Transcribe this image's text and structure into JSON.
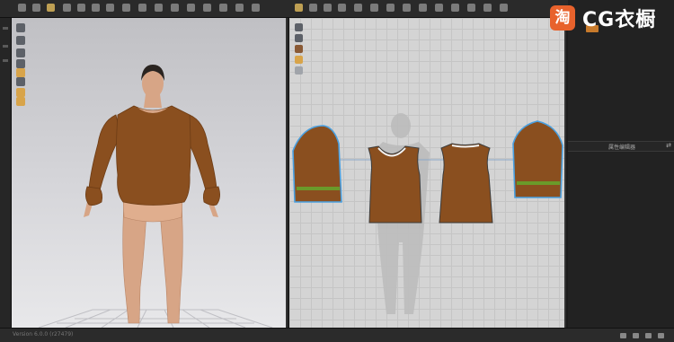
{
  "brand": {
    "logo_char": "淘",
    "name": "CG衣橱",
    "color": "#e8622c"
  },
  "panels": {
    "property_editor_title": "属性编辑器",
    "property_editor_close": "⇄"
  },
  "status": {
    "text": "Version 6.0.0 (r27479)"
  },
  "colors": {
    "garment": "#8a4f1f",
    "cuff_stripe": "#6a9a2a",
    "pattern_outline": "#4aa0e0",
    "accent": "#d8a44a"
  },
  "icons": {
    "toolbar": [
      "move-icon",
      "select-icon",
      "transform-icon",
      "fold-icon",
      "pin-icon",
      "simulate-icon",
      "avatar-icon",
      "measure-icon",
      "sewing-icon",
      "texture-icon",
      "segment-icon",
      "zoom-icon"
    ],
    "viewport3d": [
      "camera-icon",
      "view-icon",
      "display-icon",
      "light-icon",
      "brush-icon",
      "skin-icon"
    ],
    "viewport2d": [
      "ruler-icon",
      "zoom-icon",
      "sphere-icon",
      "star-icon",
      "note-icon"
    ]
  }
}
